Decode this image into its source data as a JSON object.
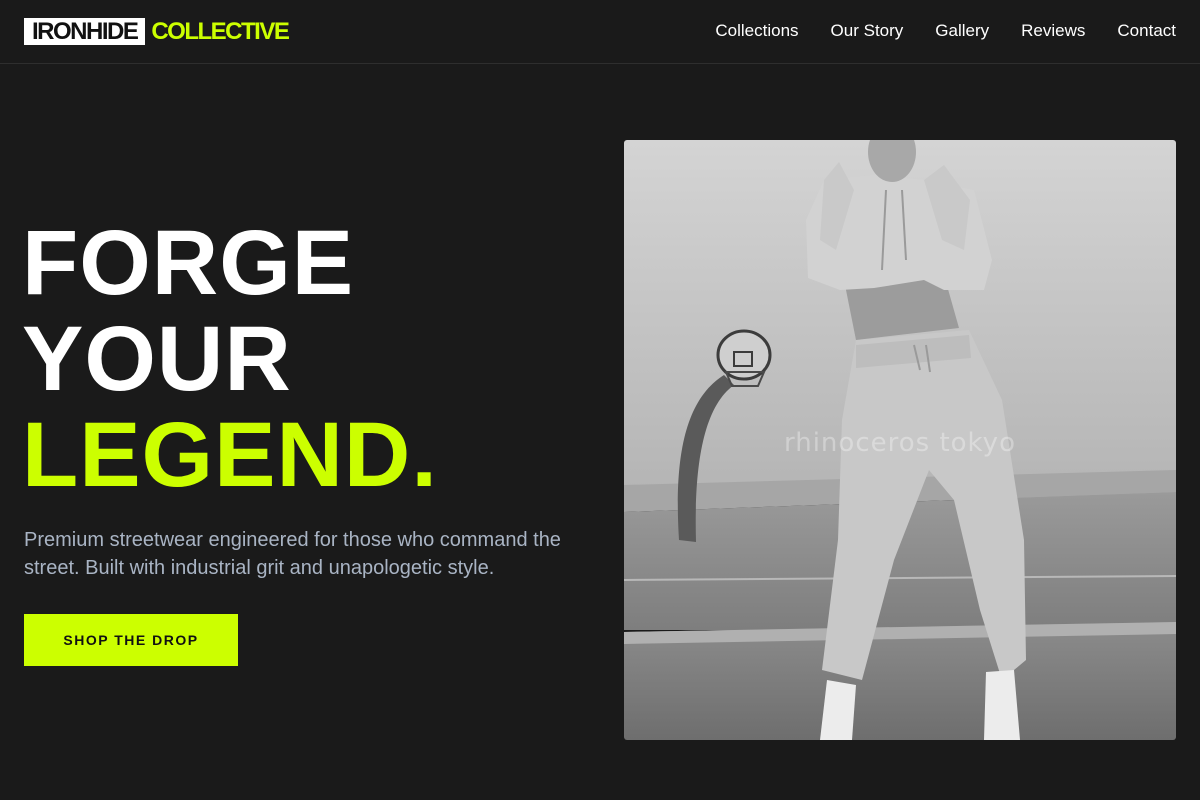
{
  "brand": {
    "name_primary": "IRONHIDE",
    "name_accent": "COLLECTIVE"
  },
  "nav": {
    "links": [
      {
        "label": "Collections"
      },
      {
        "label": "Our Story"
      },
      {
        "label": "Gallery"
      },
      {
        "label": "Reviews"
      },
      {
        "label": "Contact"
      }
    ]
  },
  "hero": {
    "title_line1": "FORGE",
    "title_line2": "YOUR",
    "title_line3": "LEGEND.",
    "subtitle": "Premium streetwear engineered for those who command the street. Built with industrial grit and unapologetic style.",
    "cta_label": "SHOP THE DROP",
    "image": {
      "watermark": "rhinoceros tokyo"
    }
  },
  "colors": {
    "background": "#1a1a1a",
    "accent": "#ccff00",
    "text": "#ffffff",
    "muted_text": "#a9b4c4"
  }
}
